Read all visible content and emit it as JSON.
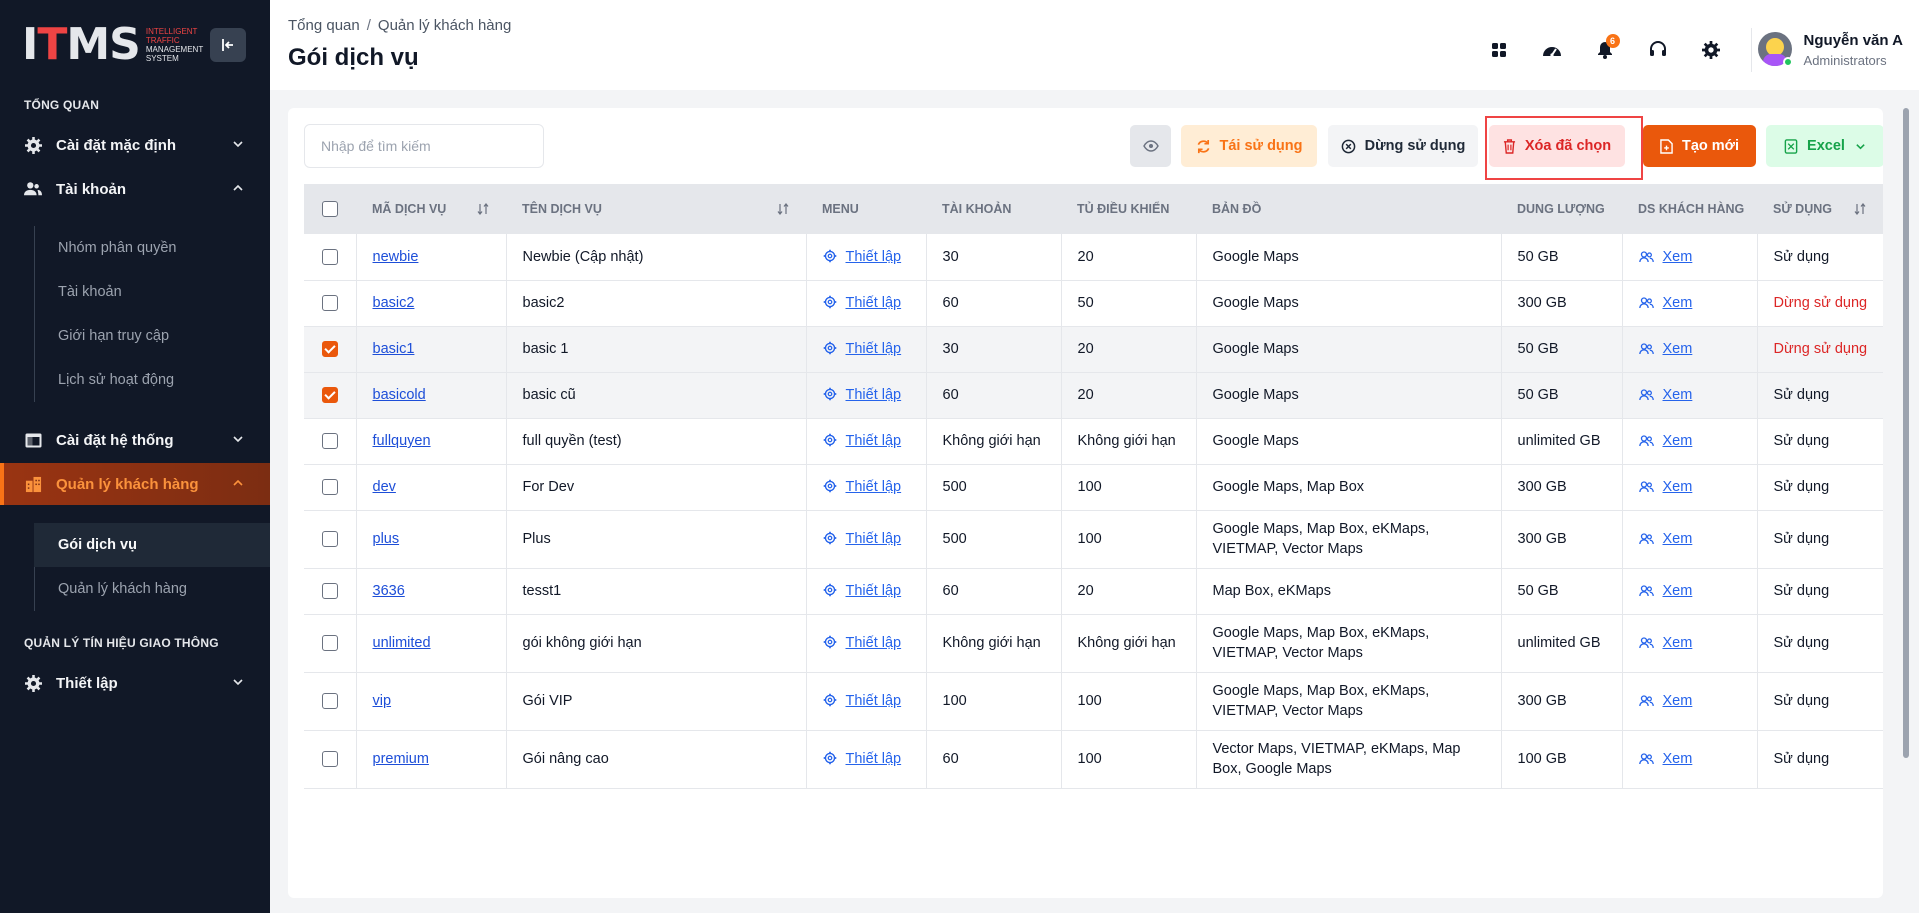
{
  "sidebar": {
    "logo_text": "ITMS",
    "logo_sub_lines": [
      "INTELLIGENT",
      "TRAFFIC",
      "MANAGEMENT",
      "SYSTEM"
    ],
    "section_overview": "TỔNG QUAN",
    "items": [
      {
        "label": "Cài đặt mặc định"
      },
      {
        "label": "Tài khoản"
      },
      {
        "label": "Cài đặt hệ thống"
      },
      {
        "label": "Quản lý khách hàng"
      },
      {
        "label": "Thiết lập"
      }
    ],
    "account_sub": [
      "Nhóm phân quyền",
      "Tài khoản",
      "Giới hạn truy cập",
      "Lịch sử hoạt động"
    ],
    "customer_sub": [
      "Gói dịch vụ",
      "Quản lý khách hàng"
    ],
    "section_traffic": "QUẢN LÝ TÍN HIỆU GIAO THÔNG"
  },
  "header": {
    "breadcrumb": [
      "Tổng quan",
      "Quản lý khách hàng"
    ],
    "breadcrumb_sep": "/",
    "title": "Gói dịch vụ",
    "notification_count": "6",
    "user_name": "Nguyễn văn A",
    "user_role": "Administrators"
  },
  "toolbar": {
    "search_placeholder": "Nhập để tìm kiếm",
    "reuse_label": "Tái sử dụng",
    "stop_label": "Dừng sử dụng",
    "delete_label": "Xóa đã chọn",
    "new_label": "Tạo mới",
    "excel_label": "Excel"
  },
  "table": {
    "columns": [
      "MÃ DỊCH VỤ",
      "TÊN DỊCH VỤ",
      "MENU",
      "TÀI KHOẢN",
      "TỦ ĐIỀU KHIỂN",
      "BẢN ĐỒ",
      "DUNG LƯỢNG",
      "DS KHÁCH HÀNG",
      "SỬ DỤNG"
    ],
    "rows": [
      {
        "code": "newbie",
        "name": "Newbie (Cập nhật)",
        "menu": "Thiết lập",
        "accounts": "30",
        "cabinets": "20",
        "maps": "Google Maps",
        "storage": "50 GB",
        "customers": "Xem",
        "status": "Sử dụng",
        "status_type": "active",
        "checked": false
      },
      {
        "code": "basic2",
        "name": "basic2",
        "menu": "Thiết lập",
        "accounts": "60",
        "cabinets": "50",
        "maps": "Google Maps",
        "storage": "300 GB",
        "customers": "Xem",
        "status": "Dừng sử dụng",
        "status_type": "stopped",
        "checked": false
      },
      {
        "code": "basic1",
        "name": "basic 1",
        "menu": "Thiết lập",
        "accounts": "30",
        "cabinets": "20",
        "maps": "Google Maps",
        "storage": "50 GB",
        "customers": "Xem",
        "status": "Dừng sử dụng",
        "status_type": "stopped",
        "checked": true
      },
      {
        "code": "basicold",
        "name": "basic cũ",
        "menu": "Thiết lập",
        "accounts": "60",
        "cabinets": "20",
        "maps": "Google Maps",
        "storage": "50 GB",
        "customers": "Xem",
        "status": "Sử dụng",
        "status_type": "active",
        "checked": true
      },
      {
        "code": "fullquyen",
        "name": "full quyền (test)",
        "menu": "Thiết lập",
        "accounts": "Không giới hạn",
        "cabinets": "Không giới hạn",
        "maps": "Google Maps",
        "storage": "unlimited GB",
        "customers": "Xem",
        "status": "Sử dụng",
        "status_type": "active",
        "checked": false
      },
      {
        "code": "dev",
        "name": "For Dev",
        "menu": "Thiết lập",
        "accounts": "500",
        "cabinets": "100",
        "maps": "Google Maps, Map Box",
        "storage": "300 GB",
        "customers": "Xem",
        "status": "Sử dụng",
        "status_type": "active",
        "checked": false
      },
      {
        "code": "plus",
        "name": "Plus",
        "menu": "Thiết lập",
        "accounts": "500",
        "cabinets": "100",
        "maps": "Google Maps, Map Box, eKMaps, VIETMAP, Vector Maps",
        "storage": "300 GB",
        "customers": "Xem",
        "status": "Sử dụng",
        "status_type": "active",
        "checked": false
      },
      {
        "code": "3636",
        "name": "tesst1",
        "menu": "Thiết lập",
        "accounts": "60",
        "cabinets": "20",
        "maps": "Map Box, eKMaps",
        "storage": "50 GB",
        "customers": "Xem",
        "status": "Sử dụng",
        "status_type": "active",
        "checked": false
      },
      {
        "code": "unlimited",
        "name": "gói không giới hạn",
        "menu": "Thiết lập",
        "accounts": "Không giới hạn",
        "cabinets": "Không giới hạn",
        "maps": "Google Maps, Map Box, eKMaps, VIETMAP, Vector Maps",
        "storage": "unlimited GB",
        "customers": "Xem",
        "status": "Sử dụng",
        "status_type": "active",
        "checked": false
      },
      {
        "code": "vip",
        "name": "Gói VIP",
        "menu": "Thiết lập",
        "accounts": "100",
        "cabinets": "100",
        "maps": "Google Maps, Map Box, eKMaps, VIETMAP, Vector Maps",
        "storage": "300 GB",
        "customers": "Xem",
        "status": "Sử dụng",
        "status_type": "active",
        "checked": false
      },
      {
        "code": "premium",
        "name": "Gói nâng cao",
        "menu": "Thiết lập",
        "accounts": "60",
        "cabinets": "100",
        "maps": "Vector Maps, VIETMAP, eKMaps, Map Box, Google Maps",
        "storage": "100 GB",
        "customers": "Xem",
        "status": "Sử dụng",
        "status_type": "active",
        "checked": false
      }
    ]
  },
  "colors": {
    "sidebar_bg": "#111827",
    "accent": "#ea580c",
    "danger": "#dc2626",
    "link": "#2563eb"
  }
}
